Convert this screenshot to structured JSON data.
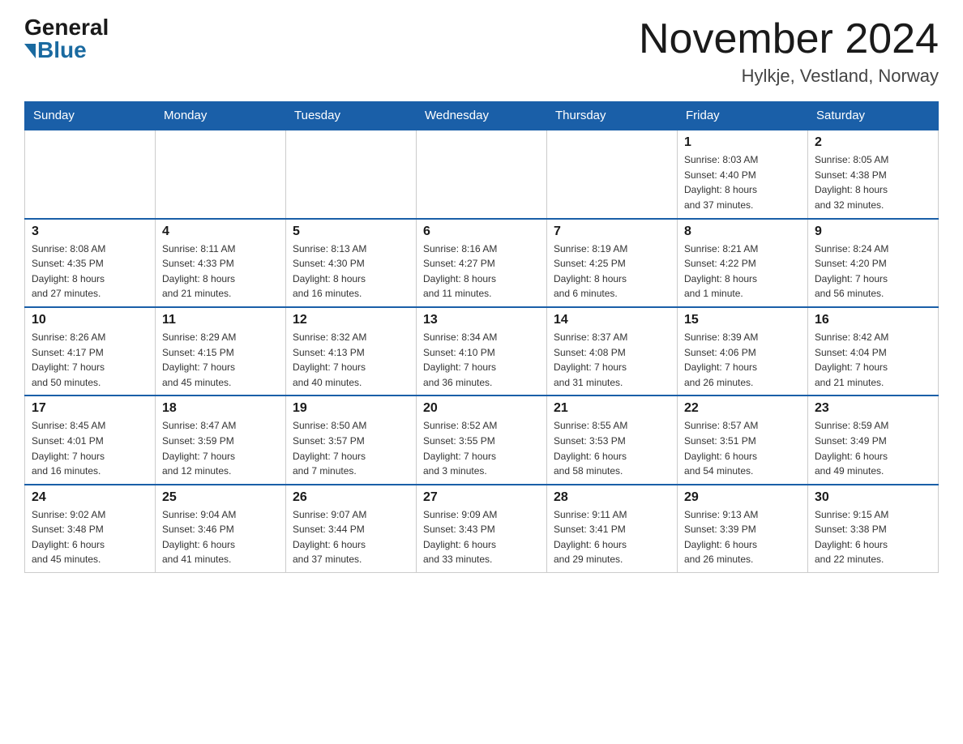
{
  "logo": {
    "general": "General",
    "blue": "Blue"
  },
  "header": {
    "title": "November 2024",
    "subtitle": "Hylkje, Vestland, Norway"
  },
  "days_of_week": [
    "Sunday",
    "Monday",
    "Tuesday",
    "Wednesday",
    "Thursday",
    "Friday",
    "Saturday"
  ],
  "weeks": [
    [
      {
        "day": "",
        "info": ""
      },
      {
        "day": "",
        "info": ""
      },
      {
        "day": "",
        "info": ""
      },
      {
        "day": "",
        "info": ""
      },
      {
        "day": "",
        "info": ""
      },
      {
        "day": "1",
        "info": "Sunrise: 8:03 AM\nSunset: 4:40 PM\nDaylight: 8 hours\nand 37 minutes."
      },
      {
        "day": "2",
        "info": "Sunrise: 8:05 AM\nSunset: 4:38 PM\nDaylight: 8 hours\nand 32 minutes."
      }
    ],
    [
      {
        "day": "3",
        "info": "Sunrise: 8:08 AM\nSunset: 4:35 PM\nDaylight: 8 hours\nand 27 minutes."
      },
      {
        "day": "4",
        "info": "Sunrise: 8:11 AM\nSunset: 4:33 PM\nDaylight: 8 hours\nand 21 minutes."
      },
      {
        "day": "5",
        "info": "Sunrise: 8:13 AM\nSunset: 4:30 PM\nDaylight: 8 hours\nand 16 minutes."
      },
      {
        "day": "6",
        "info": "Sunrise: 8:16 AM\nSunset: 4:27 PM\nDaylight: 8 hours\nand 11 minutes."
      },
      {
        "day": "7",
        "info": "Sunrise: 8:19 AM\nSunset: 4:25 PM\nDaylight: 8 hours\nand 6 minutes."
      },
      {
        "day": "8",
        "info": "Sunrise: 8:21 AM\nSunset: 4:22 PM\nDaylight: 8 hours\nand 1 minute."
      },
      {
        "day": "9",
        "info": "Sunrise: 8:24 AM\nSunset: 4:20 PM\nDaylight: 7 hours\nand 56 minutes."
      }
    ],
    [
      {
        "day": "10",
        "info": "Sunrise: 8:26 AM\nSunset: 4:17 PM\nDaylight: 7 hours\nand 50 minutes."
      },
      {
        "day": "11",
        "info": "Sunrise: 8:29 AM\nSunset: 4:15 PM\nDaylight: 7 hours\nand 45 minutes."
      },
      {
        "day": "12",
        "info": "Sunrise: 8:32 AM\nSunset: 4:13 PM\nDaylight: 7 hours\nand 40 minutes."
      },
      {
        "day": "13",
        "info": "Sunrise: 8:34 AM\nSunset: 4:10 PM\nDaylight: 7 hours\nand 36 minutes."
      },
      {
        "day": "14",
        "info": "Sunrise: 8:37 AM\nSunset: 4:08 PM\nDaylight: 7 hours\nand 31 minutes."
      },
      {
        "day": "15",
        "info": "Sunrise: 8:39 AM\nSunset: 4:06 PM\nDaylight: 7 hours\nand 26 minutes."
      },
      {
        "day": "16",
        "info": "Sunrise: 8:42 AM\nSunset: 4:04 PM\nDaylight: 7 hours\nand 21 minutes."
      }
    ],
    [
      {
        "day": "17",
        "info": "Sunrise: 8:45 AM\nSunset: 4:01 PM\nDaylight: 7 hours\nand 16 minutes."
      },
      {
        "day": "18",
        "info": "Sunrise: 8:47 AM\nSunset: 3:59 PM\nDaylight: 7 hours\nand 12 minutes."
      },
      {
        "day": "19",
        "info": "Sunrise: 8:50 AM\nSunset: 3:57 PM\nDaylight: 7 hours\nand 7 minutes."
      },
      {
        "day": "20",
        "info": "Sunrise: 8:52 AM\nSunset: 3:55 PM\nDaylight: 7 hours\nand 3 minutes."
      },
      {
        "day": "21",
        "info": "Sunrise: 8:55 AM\nSunset: 3:53 PM\nDaylight: 6 hours\nand 58 minutes."
      },
      {
        "day": "22",
        "info": "Sunrise: 8:57 AM\nSunset: 3:51 PM\nDaylight: 6 hours\nand 54 minutes."
      },
      {
        "day": "23",
        "info": "Sunrise: 8:59 AM\nSunset: 3:49 PM\nDaylight: 6 hours\nand 49 minutes."
      }
    ],
    [
      {
        "day": "24",
        "info": "Sunrise: 9:02 AM\nSunset: 3:48 PM\nDaylight: 6 hours\nand 45 minutes."
      },
      {
        "day": "25",
        "info": "Sunrise: 9:04 AM\nSunset: 3:46 PM\nDaylight: 6 hours\nand 41 minutes."
      },
      {
        "day": "26",
        "info": "Sunrise: 9:07 AM\nSunset: 3:44 PM\nDaylight: 6 hours\nand 37 minutes."
      },
      {
        "day": "27",
        "info": "Sunrise: 9:09 AM\nSunset: 3:43 PM\nDaylight: 6 hours\nand 33 minutes."
      },
      {
        "day": "28",
        "info": "Sunrise: 9:11 AM\nSunset: 3:41 PM\nDaylight: 6 hours\nand 29 minutes."
      },
      {
        "day": "29",
        "info": "Sunrise: 9:13 AM\nSunset: 3:39 PM\nDaylight: 6 hours\nand 26 minutes."
      },
      {
        "day": "30",
        "info": "Sunrise: 9:15 AM\nSunset: 3:38 PM\nDaylight: 6 hours\nand 22 minutes."
      }
    ]
  ]
}
